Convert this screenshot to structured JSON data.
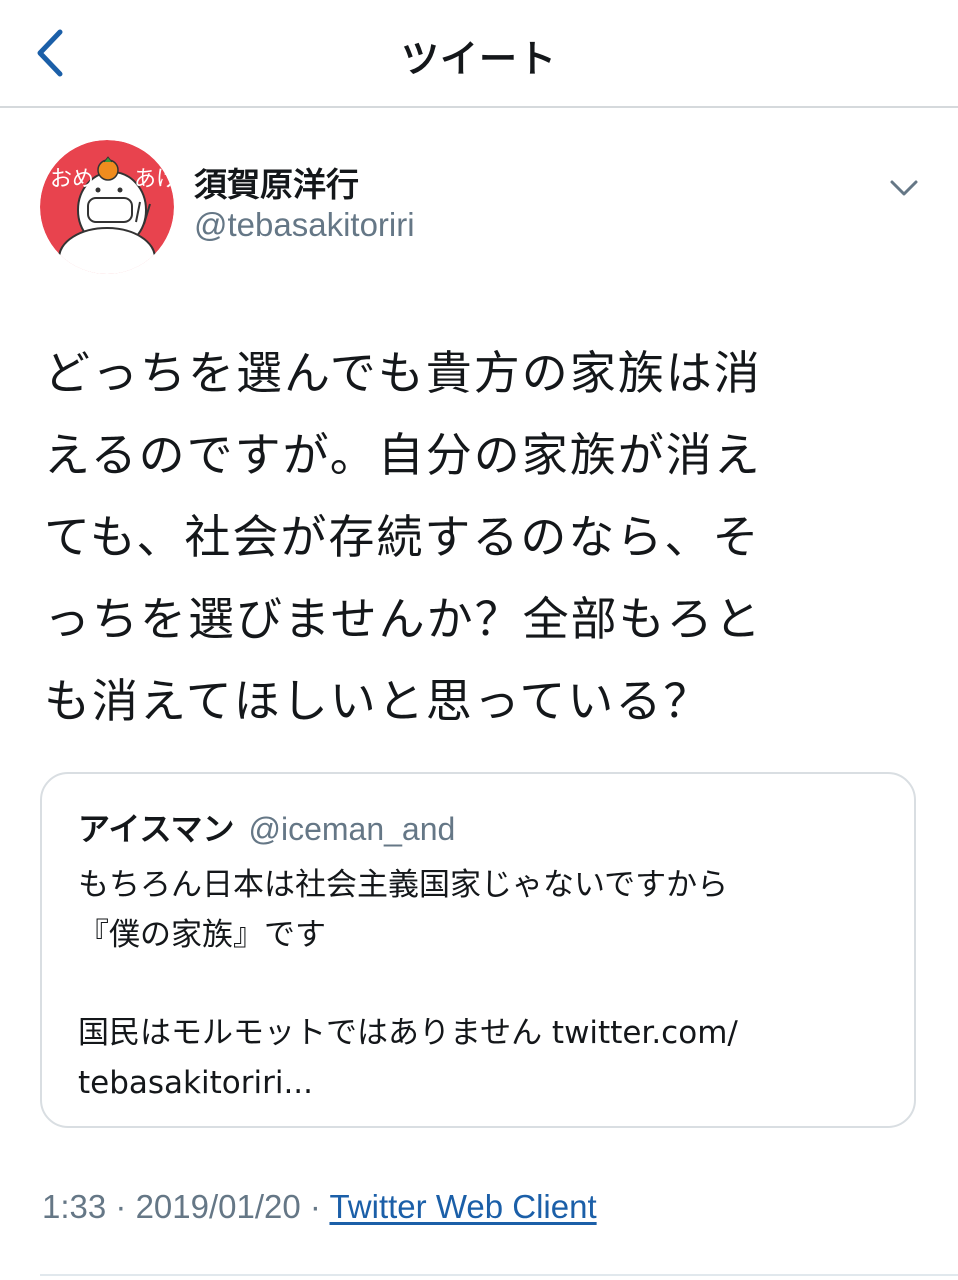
{
  "header": {
    "title": "ツイート",
    "back_icon": "chevron-left-icon"
  },
  "author": {
    "name": "須賀原洋行",
    "handle": "@tebasakitoriri",
    "avatar_text_left": "おめ",
    "avatar_text_right": "あけ",
    "avatar_bg_color": "#e8434e"
  },
  "tweet": {
    "lines": [
      "どっちを選んでも貴方の家族は消",
      "えるのですが。自分の家族が消え",
      "ても、社会が存続するのなら、そ",
      "っちを選びませんか？全部もろと",
      "も消えてほしいと思っている？"
    ]
  },
  "quote": {
    "name": "アイスマン",
    "handle": "@iceman_and",
    "lines_1": [
      "もちろん日本は社会主義国家じゃないですから",
      "『僕の家族』です"
    ],
    "lines_2": [
      "国民はモルモットではありません twitter.com/",
      "tebasakitoriri..."
    ]
  },
  "meta": {
    "time": "1:33",
    "separator": " · ",
    "date": "2019/01/20",
    "source": "Twitter Web Client",
    "link_color": "#1b5fa8"
  }
}
